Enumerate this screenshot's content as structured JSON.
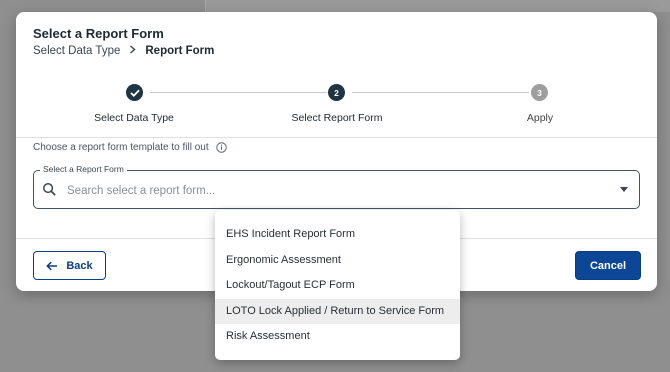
{
  "modal": {
    "title": "Select a Report Form",
    "breadcrumb": {
      "first": "Select Data Type",
      "current": "Report Form"
    }
  },
  "stepper": {
    "steps": [
      {
        "label": "Select Data Type",
        "state": "done",
        "number": ""
      },
      {
        "label": "Select Report Form",
        "state": "active",
        "number": "2"
      },
      {
        "label": "Apply",
        "state": "pending",
        "number": "3"
      }
    ]
  },
  "helper_text": "Choose a report form template to fill out",
  "select_field": {
    "label": "Select a Report Form",
    "placeholder": "Search select a report form...",
    "value": ""
  },
  "buttons": {
    "back": "Back",
    "cancel": "Cancel"
  },
  "dropdown": {
    "options": [
      "EHS Incident Report Form",
      "Ergonomic Assessment",
      "Lockout/Tagout ECP Form",
      "LOTO Lock Applied / Return to Service Form",
      "Risk Assessment"
    ],
    "highlighted_index": 3
  },
  "colors": {
    "primary": "#0c4696",
    "step_active": "#1f3544",
    "step_pending": "#9e9e9e",
    "overlay": "#8f8f8f"
  },
  "icons": [
    "check-icon",
    "info-icon",
    "search-icon",
    "caret-down-icon",
    "arrow-left-icon"
  ]
}
